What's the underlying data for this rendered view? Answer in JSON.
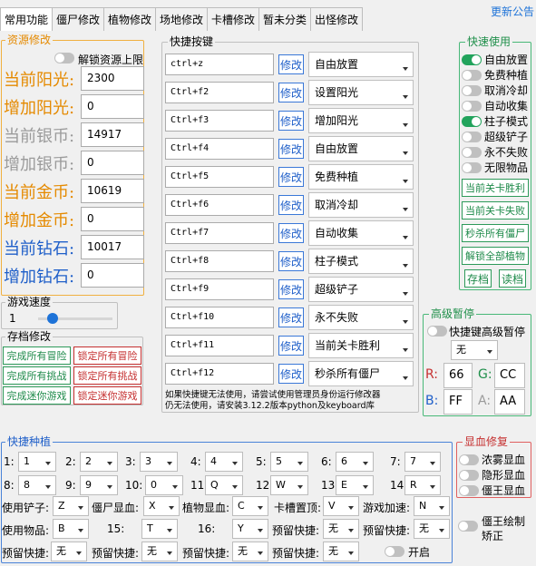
{
  "tabs": [
    {
      "label": "常用功能"
    },
    {
      "label": "僵尸修改"
    },
    {
      "label": "植物修改"
    },
    {
      "label": "场地修改"
    },
    {
      "label": "卡槽修改"
    },
    {
      "label": "暂未分类"
    },
    {
      "label": "出怪修改"
    }
  ],
  "update_link": "更新公告",
  "resources": {
    "title": "资源修改",
    "unlock_label": "解锁资源上限",
    "rows": [
      {
        "label": "当前阳光:",
        "value": "2300",
        "color": "#e58a00"
      },
      {
        "label": "增加阳光:",
        "value": "0",
        "color": "#e58a00"
      },
      {
        "label": "当前银币:",
        "value": "14917",
        "color": "#9b9b9b"
      },
      {
        "label": "增加银币:",
        "value": "0",
        "color": "#9b9b9b"
      },
      {
        "label": "当前金币:",
        "value": "10619",
        "color": "#e58a00"
      },
      {
        "label": "增加金币:",
        "value": "0",
        "color": "#e58a00"
      },
      {
        "label": "当前钻石:",
        "value": "10017",
        "color": "#1f5fc9"
      },
      {
        "label": "增加钻石:",
        "value": "0",
        "color": "#1f5fc9"
      }
    ]
  },
  "speed": {
    "title": "游戏速度",
    "value": "1",
    "level": 0.2
  },
  "save": {
    "title": "存档修改",
    "green_buttons": [
      "完成所有冒险",
      "完成所有挑战",
      "完成迷你游戏"
    ],
    "red_buttons": [
      "锁定所有冒险",
      "锁定所有挑战",
      "锁定迷你游戏"
    ]
  },
  "hotkeys": {
    "title": "快捷按键",
    "edit_label": "修改",
    "rows": [
      {
        "key": "ctrl+z",
        "action": "自由放置"
      },
      {
        "key": "Ctrl+f2",
        "action": "设置阳光"
      },
      {
        "key": "Ctrl+f3",
        "action": "增加阳光"
      },
      {
        "key": "Ctrl+f4",
        "action": "自由放置"
      },
      {
        "key": "Ctrl+f5",
        "action": "免费种植"
      },
      {
        "key": "Ctrl+f6",
        "action": "取消冷却"
      },
      {
        "key": "Ctrl+f7",
        "action": "自动收集"
      },
      {
        "key": "Ctrl+f8",
        "action": "柱子模式"
      },
      {
        "key": "Ctrl+f9",
        "action": "超级铲子"
      },
      {
        "key": "Ctrl+f10",
        "action": "永不失败"
      },
      {
        "key": "Ctrl+f11",
        "action": "当前关卡胜利"
      },
      {
        "key": "Ctrl+f12",
        "action": "秒杀所有僵尸"
      }
    ],
    "note_line1": "如果快捷键无法使用，请尝试使用管理员身份运行修改器",
    "note_line2": "仍无法使用，请安装3.12.2版本python及keyboard库"
  },
  "quick": {
    "title": "快速使用",
    "items": [
      {
        "label": "自由放置",
        "on": true
      },
      {
        "label": "免费种植",
        "on": false
      },
      {
        "label": "取消冷却",
        "on": false
      },
      {
        "label": "自动收集",
        "on": false
      },
      {
        "label": "柱子模式",
        "on": true
      },
      {
        "label": "超级铲子",
        "on": false
      },
      {
        "label": "永不失败",
        "on": false
      },
      {
        "label": "无限物品",
        "on": false
      }
    ],
    "buttons": [
      "当前关卡胜利",
      "当前关卡失败",
      "秒杀所有僵尸",
      "解锁全部植物"
    ],
    "save_label": "存档",
    "load_label": "读档"
  },
  "pause": {
    "title": "高级暂停",
    "hotkey_label": "快捷键高级暂停",
    "select_value": "无",
    "r_label": "R:",
    "r_value": "66",
    "g_label": "G:",
    "g_value": "CC",
    "b_label": "B:",
    "b_value": "FF",
    "a_label": "A:",
    "a_value": "AA"
  },
  "quickplant": {
    "title": "快捷种植",
    "slots": [
      {
        "n": "1:",
        "k": "1"
      },
      {
        "n": "2:",
        "k": "2"
      },
      {
        "n": "3:",
        "k": "3"
      },
      {
        "n": "4:",
        "k": "4"
      },
      {
        "n": "5:",
        "k": "5"
      },
      {
        "n": "6:",
        "k": "6"
      },
      {
        "n": "7:",
        "k": "7"
      },
      {
        "n": "8:",
        "k": "8"
      },
      {
        "n": "9:",
        "k": "9"
      },
      {
        "n": "10:",
        "k": "0"
      },
      {
        "n": "11:",
        "k": "Q"
      },
      {
        "n": "12:",
        "k": "W"
      },
      {
        "n": "13:",
        "k": "E"
      },
      {
        "n": "14:",
        "k": "R"
      }
    ],
    "row3": [
      {
        "n": "使用铲子:",
        "k": "Z"
      },
      {
        "n": "僵尸显血:",
        "k": "X"
      },
      {
        "n": "植物显血:",
        "k": "C"
      },
      {
        "n": "卡槽置顶:",
        "k": "V"
      },
      {
        "n": "游戏加速:",
        "k": "N"
      }
    ],
    "row4": [
      {
        "n": "使用物品:",
        "k": "B"
      },
      {
        "n": "15:",
        "k": "T"
      },
      {
        "n": "16:",
        "k": "Y"
      },
      {
        "n": "预留快捷:",
        "k": "无"
      },
      {
        "n": "预留快捷:",
        "k": "无"
      }
    ],
    "row5": [
      {
        "n": "预留快捷:",
        "k": "无"
      },
      {
        "n": "预留快捷:",
        "k": "无"
      },
      {
        "n": "预留快捷:",
        "k": "无"
      },
      {
        "n": "预留快捷:",
        "k": "无"
      }
    ],
    "enable_label": "开启"
  },
  "blood": {
    "title": "显血修复",
    "items": [
      "浓雾显血",
      "隐形显血",
      "僵王显血"
    ],
    "zombie_king_line1": "僵王绘制",
    "zombie_king_line2": "矫正"
  }
}
